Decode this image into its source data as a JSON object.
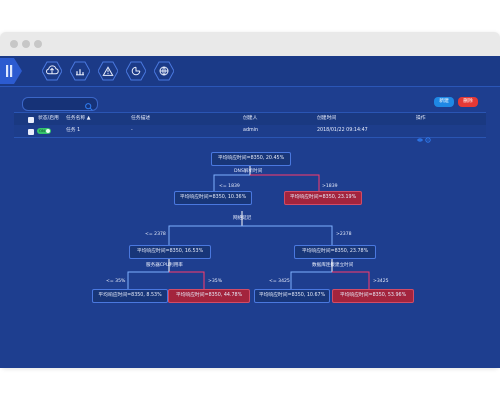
{
  "toolbar": {
    "search_placeholder": "",
    "new_label": "新建",
    "delete_label": "删除"
  },
  "nav": {
    "icons": [
      "cloud-upload-icon",
      "bar-chart-icon",
      "warning-icon",
      "pie-chart-icon",
      "globe-icon"
    ]
  },
  "table": {
    "headers": [
      "状态/启用",
      "任务名称 ▲",
      "任务描述",
      "创建人",
      "创建时间",
      "操作"
    ],
    "row": {
      "toggle_label": "ON",
      "task_name": "任务 1",
      "task_desc": "-",
      "creator": "admin",
      "created_at": "2018/01/22 09:14:47"
    }
  },
  "tree": {
    "root": "平均响应时间=8350, 20.45%",
    "root_feature": "DNS解析时间",
    "left_cond_root": "<= 1839",
    "right_cond_root": ">1839",
    "l1_left": "平均响应时间=8350, 10.36%",
    "l1_right": "平均响应时间=8350, 23.19%",
    "l1_feature": "网络延迟",
    "left_cond_l1": "<= 2378",
    "right_cond_l1": ">2378",
    "l2_left": "平均响应时间=8350, 16.53%",
    "l2_right": "平均响应时间=8350, 23.78%",
    "l2_left_feature": "服务器CPU利用率",
    "l2_right_feature": "数据库连接建立时间",
    "left_cond_l2_left": "<= 35%",
    "right_cond_l2_left": ">35%",
    "left_cond_l2_right": "<= 3425",
    "right_cond_l2_right": ">3425",
    "l3_ll": "平均响应时间=8350, 8.53%",
    "l3_lr": "平均响应时间=8350, 44.78%",
    "l3_rl": "平均响应时间=8350, 10.67%",
    "l3_rr": "平均响应时间=8350, 53.96%"
  },
  "colors": {
    "app_bg": "#1e3e8f",
    "new_button": "#1e88e5",
    "delete_button": "#e53935",
    "red_node": "#a3243d",
    "blue_node": "#183679",
    "toggle_on": "#35c36b"
  }
}
